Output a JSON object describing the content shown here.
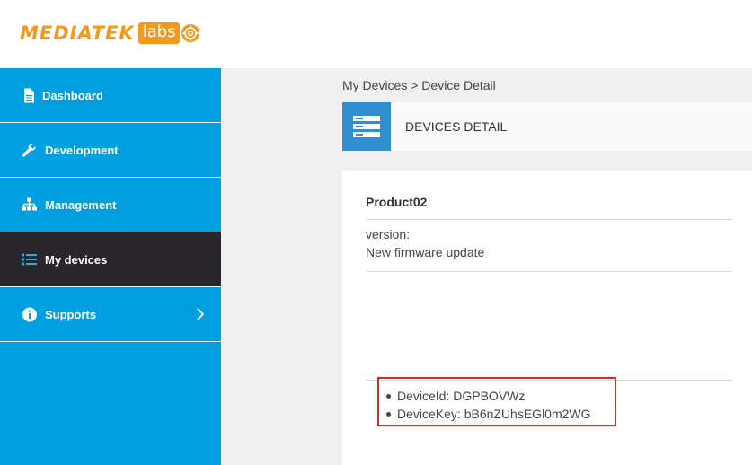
{
  "brand": {
    "logo_main": "MEDIATEK",
    "logo_labs": "labs",
    "color": "#f39a1e"
  },
  "sidebar": {
    "items": [
      {
        "label": "Dashboard",
        "icon": "document-icon",
        "active": false
      },
      {
        "label": "Development",
        "icon": "wrench-icon",
        "active": false
      },
      {
        "label": "Management",
        "icon": "sitemap-icon",
        "active": false
      },
      {
        "label": "My devices",
        "icon": "list-icon",
        "active": true
      },
      {
        "label": "Supports",
        "icon": "info-icon",
        "active": false,
        "has_submenu": true
      }
    ],
    "bg_color": "#00a0e0",
    "active_color": "#28262b"
  },
  "breadcrumb": "My Devices > Device Detail",
  "page_title": "DEVICES DETAIL",
  "device": {
    "name": "Product02",
    "version_label": "version:",
    "version_value": "New firmware update",
    "details": [
      "DeviceId: DGPBOVWz",
      "DeviceKey: bB6nZUhsEGl0m2WG"
    ]
  }
}
